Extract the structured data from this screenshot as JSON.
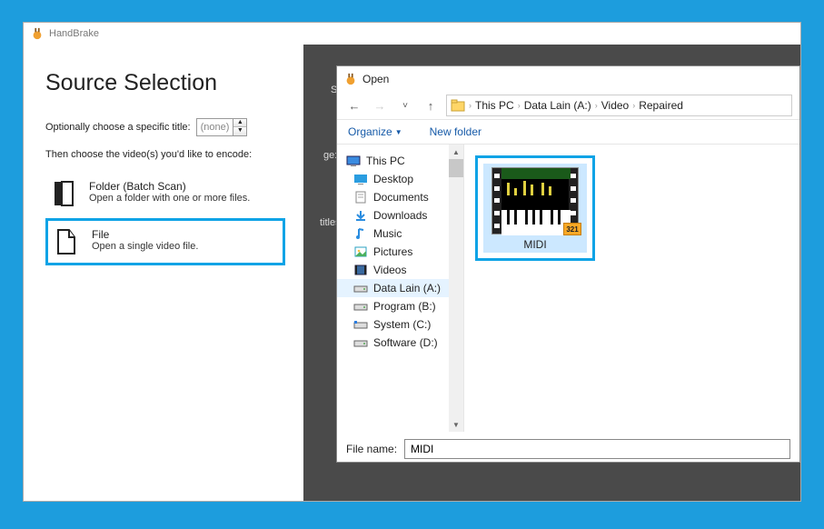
{
  "handbrake": {
    "title": "HandBrake",
    "heading": "Source Selection",
    "row1_label": "Optionally choose a specific title:",
    "spinner_value": "(none)",
    "row2_label": "Then choose the video(s) you'd like to encode:",
    "folder": {
      "title": "Folder (Batch Scan)",
      "desc": "Open a folder with one or more files."
    },
    "file": {
      "title": "File",
      "desc": "Open a single video file."
    },
    "dim": {
      "sta": "Sta",
      "ge": "ge:",
      "titles": "titles"
    }
  },
  "dialog": {
    "title": "Open",
    "breadcrumb": [
      "This PC",
      "Data Lain (A:)",
      "Video",
      "Repaired"
    ],
    "organize": "Organize",
    "newfolder": "New folder",
    "tree": {
      "root": "This PC",
      "items": [
        "Desktop",
        "Documents",
        "Downloads",
        "Music",
        "Pictures",
        "Videos",
        "Data Lain (A:)",
        "Program (B:)",
        "System (C:)",
        "Software (D:)"
      ]
    },
    "thumb_label": "MIDI",
    "filename_label": "File name:",
    "filename_value": "MIDI",
    "badge": "321"
  }
}
